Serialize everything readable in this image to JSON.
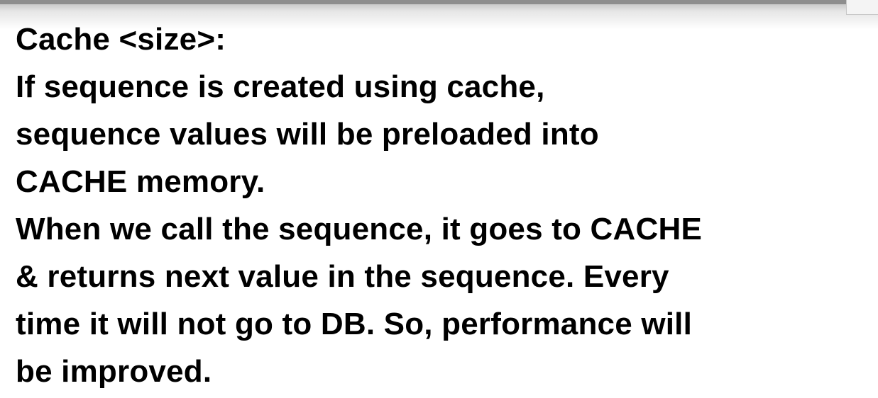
{
  "slide": {
    "lines": [
      "Cache <size>:",
      "If sequence is created using cache,",
      "sequence values will be preloaded into",
      "CACHE memory.",
      "When we call the sequence, it goes to CACHE",
      "& returns next value in the sequence. Every",
      "time it will not go to DB. So, performance will",
      "be improved."
    ]
  }
}
